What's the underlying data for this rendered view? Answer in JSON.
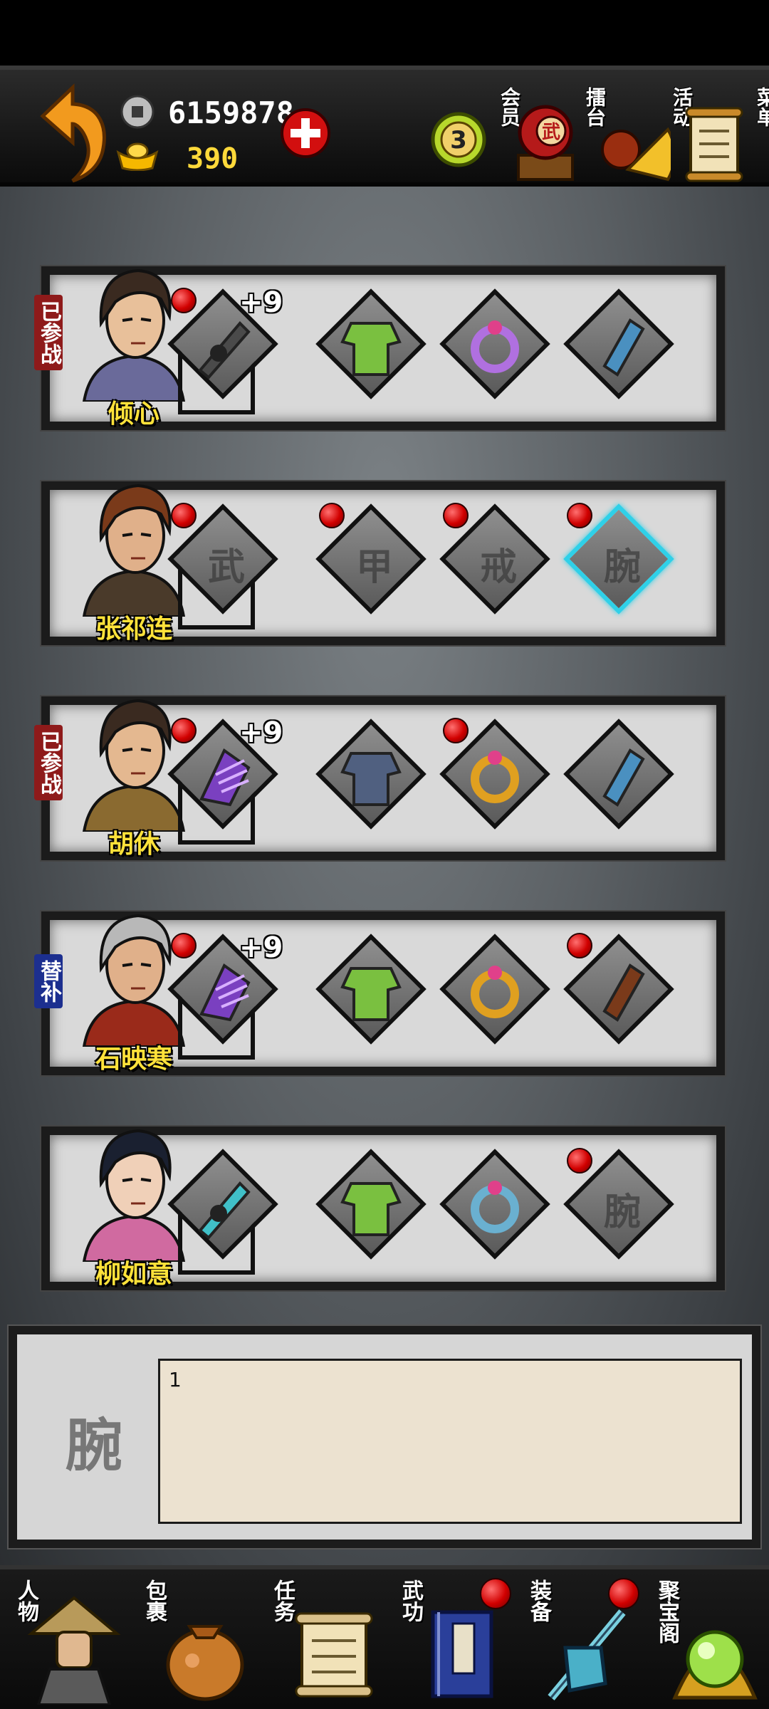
{
  "currency": {
    "silver": "6159878",
    "gold": "390"
  },
  "top_menu": [
    {
      "label": "会员",
      "badge": "3",
      "icon": "vip-badge-icon"
    },
    {
      "label": "擂台",
      "drum_text": "武",
      "icon": "arena-drum-icon"
    },
    {
      "label": "活动",
      "icon": "events-fan-icon"
    },
    {
      "label": "菜单",
      "icon": "menu-scroll-icon"
    }
  ],
  "heroes": [
    {
      "name": "倾心",
      "tag": "已参战",
      "tag_type": "joined",
      "slots": [
        {
          "type": "weapon",
          "item": "black-sword",
          "plus": "+9",
          "dot": true,
          "placeholder": ""
        },
        {
          "type": "armor",
          "item": "green-robe",
          "plus": "",
          "dot": false,
          "placeholder": ""
        },
        {
          "type": "ring",
          "item": "purple-ring",
          "plus": "",
          "dot": false,
          "placeholder": ""
        },
        {
          "type": "bracer",
          "item": "blue-bracer",
          "plus": "",
          "dot": false,
          "placeholder": ""
        }
      ]
    },
    {
      "name": "张祁连",
      "tag": "",
      "tag_type": "",
      "slots": [
        {
          "type": "weapon",
          "item": "",
          "plus": "",
          "dot": true,
          "placeholder": "武"
        },
        {
          "type": "armor",
          "item": "",
          "plus": "",
          "dot": true,
          "placeholder": "甲"
        },
        {
          "type": "ring",
          "item": "",
          "plus": "",
          "dot": true,
          "placeholder": "戒"
        },
        {
          "type": "bracer",
          "item": "",
          "plus": "",
          "dot": true,
          "placeholder": "腕",
          "selected": true
        }
      ]
    },
    {
      "name": "胡休",
      "tag": "已参战",
      "tag_type": "joined",
      "slots": [
        {
          "type": "weapon",
          "item": "purple-claw",
          "plus": "+9",
          "dot": true,
          "placeholder": ""
        },
        {
          "type": "armor",
          "item": "blue-armor",
          "plus": "",
          "dot": false,
          "placeholder": ""
        },
        {
          "type": "ring",
          "item": "gold-ring",
          "plus": "",
          "dot": true,
          "placeholder": ""
        },
        {
          "type": "bracer",
          "item": "blue-bracer",
          "plus": "",
          "dot": false,
          "placeholder": ""
        }
      ]
    },
    {
      "name": "石映寒",
      "tag": "替补",
      "tag_type": "sub",
      "slots": [
        {
          "type": "weapon",
          "item": "purple-claw",
          "plus": "+9",
          "dot": true,
          "placeholder": ""
        },
        {
          "type": "armor",
          "item": "green-robe",
          "plus": "",
          "dot": false,
          "placeholder": ""
        },
        {
          "type": "ring",
          "item": "gold-ring",
          "plus": "",
          "dot": false,
          "placeholder": ""
        },
        {
          "type": "bracer",
          "item": "brown-bracer",
          "plus": "",
          "dot": true,
          "placeholder": ""
        }
      ]
    },
    {
      "name": "柳如意",
      "tag": "",
      "tag_type": "",
      "slots": [
        {
          "type": "weapon",
          "item": "cyan-sword",
          "plus": "",
          "dot": false,
          "placeholder": ""
        },
        {
          "type": "armor",
          "item": "green-robe",
          "plus": "",
          "dot": false,
          "placeholder": ""
        },
        {
          "type": "ring",
          "item": "silver-ring",
          "plus": "",
          "dot": false,
          "placeholder": ""
        },
        {
          "type": "bracer",
          "item": "",
          "plus": "",
          "dot": true,
          "placeholder": "腕"
        }
      ]
    }
  ],
  "detail": {
    "slot_label": "腕",
    "text": "1"
  },
  "bottom_nav": [
    {
      "label": "人物",
      "icon": "character-icon",
      "dot": false
    },
    {
      "label": "包裹",
      "icon": "bag-icon",
      "dot": false
    },
    {
      "label": "任务",
      "icon": "quest-scroll-icon",
      "dot": false
    },
    {
      "label": "武功",
      "icon": "martial-book-icon",
      "dot": true
    },
    {
      "label": "装备",
      "icon": "equipment-icon",
      "dot": true
    },
    {
      "label": "聚宝阁",
      "icon": "treasure-orb-icon",
      "dot": false
    }
  ],
  "colors": {
    "gold_text": "#ffe23a",
    "joined_tag": "#8e1a1a",
    "sub_tag": "#1c2f8f",
    "selected_slot": "#2fd0e8",
    "badge_red": "#d10000"
  }
}
